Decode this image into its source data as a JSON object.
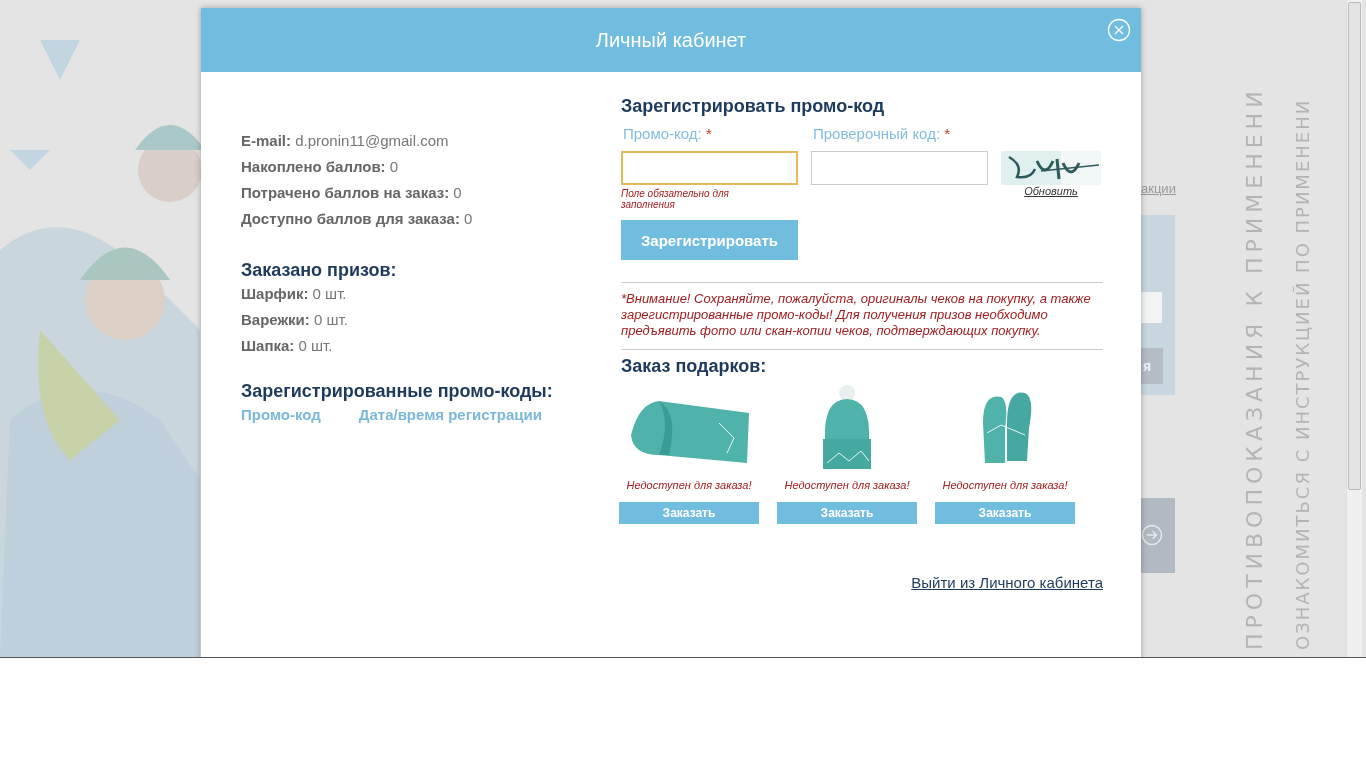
{
  "background": {
    "link": "акции",
    "button": "я",
    "side_text": [
      "ПРОТИВОПОКАЗАНИЯ К ПРИМЕНЕНИ",
      "ОЗНАКОМИТЬСЯ С ИНСТРУКЦИЕЙ ПО ПРИМЕНЕНИ"
    ]
  },
  "dialog": {
    "title": "Личный кабинет"
  },
  "account": {
    "fields": [
      {
        "label": "E-mail:",
        "value": "d.pronin11@gmail.com"
      },
      {
        "label": "Накоплено баллов:",
        "value": "0"
      },
      {
        "label": "Потрачено баллов на заказ:",
        "value": "0"
      },
      {
        "label": "Доступно баллов для заказа:",
        "value": "0"
      }
    ]
  },
  "ordered": {
    "title": "Заказано призов:",
    "items": [
      {
        "label": "Шарфик:",
        "value": "0 шт."
      },
      {
        "label": "Варежки:",
        "value": "0 шт."
      },
      {
        "label": "Шапка:",
        "value": "0 шт."
      }
    ]
  },
  "promo_list": {
    "title": "Зарегистрированные промо-коды:",
    "columns": [
      "Промо-код",
      "Дата/время регистрации"
    ]
  },
  "register": {
    "title": "Зарегистрировать промо-код",
    "promo_field": {
      "label": "Промо-код:",
      "required_mark": "*",
      "focused": true,
      "error": "Поле обязательно для заполнения"
    },
    "captcha_field": {
      "label": "Проверочный код:",
      "required_mark": "*",
      "focused": false
    },
    "refresh": "Обновить",
    "submit": "Зарегистрировать"
  },
  "notice": "*Внимание! Сохраняйте, пожалуйста, оригиналы чеков на покупку, а также зарегистрированные промо-коды! Для получения призов необходимо предъявить фото или скан-копии чеков, подтверждающих покупку.",
  "gifts": {
    "title": "Заказ подарков:",
    "items": [
      {
        "kind": "scarf",
        "status": "Недоступен для заказа!",
        "button": "Заказать"
      },
      {
        "kind": "hat",
        "status": "Недоступен для заказа!",
        "button": "Заказать"
      },
      {
        "kind": "mittens",
        "status": "Недоступен для заказа!",
        "button": "Заказать"
      }
    ]
  },
  "logout": "Выйти из Личного кабинета"
}
